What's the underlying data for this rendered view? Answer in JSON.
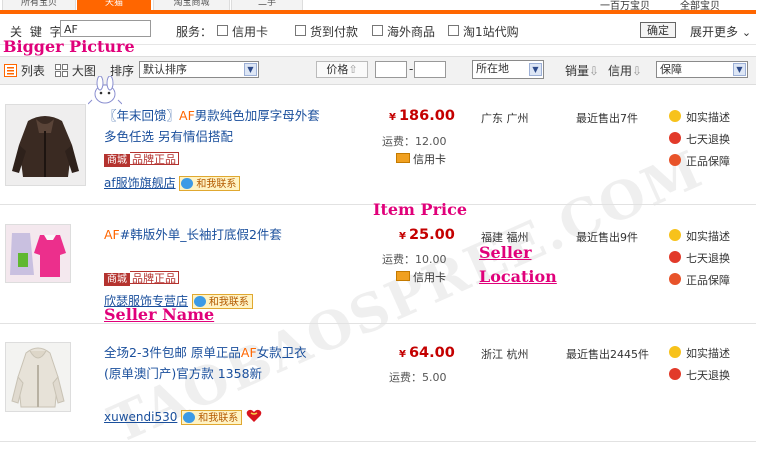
{
  "tabs": [
    "所有宝贝",
    "天猫",
    "淘宝商城",
    "二手"
  ],
  "top_right": [
    "一百万宝贝",
    "全部宝贝"
  ],
  "filter": {
    "keyword_label": "关 键 字",
    "keyword_value": "AF",
    "service_label": "服务：",
    "checkboxes": [
      "信用卡",
      "货到付款",
      "海外商品",
      "淘1站代购"
    ],
    "confirm_label": "确定",
    "expand_label": "展开更多",
    "expand_arrow": "⌄"
  },
  "annotations": {
    "bigger_picture": "Bigger Picture",
    "item_price": "Item Price",
    "seller_location_1": "Seller",
    "seller_location_2": "Location",
    "seller_name": "Seller Name"
  },
  "toolbar": {
    "list_label": "列表",
    "grid_label": "大图",
    "sort_label": "排序",
    "sort_value": "默认排序",
    "price_label": "价格",
    "range_sep": "-",
    "location_value": "所在地",
    "sales_label": "销量",
    "credit_label": "信用",
    "guarantee_value": "保障",
    "sort_arrow": "⇧",
    "down_arrow": "⇩",
    "select_arrow": "▼"
  },
  "items": [
    {
      "title_prefix": "〖年末回馈〗",
      "title_hl": "AF",
      "title_rest": "男款纯色加厚字母外套",
      "title_line2": "多色任选 另有情侣搭配",
      "mall_badge": "商城",
      "genuine_badge": "品牌正品",
      "seller": "af服饰旗舰店",
      "contact": "和我联系",
      "price": "186.00",
      "currency": "¥",
      "shipping": "运费：12.00",
      "credit_card": "信用卡",
      "location": "广东 广州",
      "sold": "最近售出7件",
      "services": [
        "如实描述",
        "七天退换",
        "正品保障"
      ]
    },
    {
      "title_hl": "AF",
      "title_rest": "#韩版外单_长袖打底假2件套",
      "mall_badge": "商城",
      "genuine_badge": "品牌正品",
      "seller": "欣瑟服饰专营店",
      "contact": "和我联系",
      "price": "25.00",
      "currency": "¥",
      "shipping": "运费：10.00",
      "credit_card": "信用卡",
      "location": "福建 福州",
      "sold": "最近售出9件",
      "services": [
        "如实描述",
        "七天退换",
        "正品保障"
      ]
    },
    {
      "title_pre": "全场2-3件包邮 原单正品",
      "title_hl": "AF",
      "title_rest": "女款卫衣",
      "title_line2": "(原单澳门产)官方款 1358新",
      "seller": "xuwendi530",
      "contact": "和我联系",
      "price": "64.00",
      "currency": "¥",
      "shipping": "运费：5.00",
      "location": "浙江 杭州",
      "sold": "最近售出2445件",
      "services": [
        "如实描述",
        "七天退换"
      ]
    }
  ],
  "watermark": "TAOBAOSPREE.COM",
  "colors": {
    "accent": "#ff6600",
    "price": "#c40000",
    "link": "#1a4f9c",
    "annotation": "#e0007a"
  }
}
